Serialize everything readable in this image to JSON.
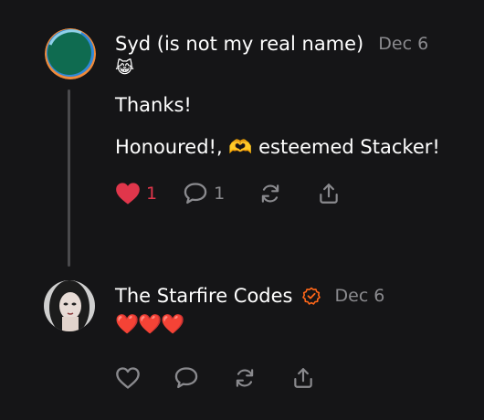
{
  "comments": [
    {
      "author": "Syd (is not my real name)",
      "date": "Dec 6",
      "emoji": "😹",
      "paragraphs": [
        "Thanks!",
        "Honoured!, 🫶 esteemed Stacker!"
      ],
      "like_count": "1",
      "reply_count": "1",
      "liked": true
    },
    {
      "author": "The Starfire Codes",
      "verified": true,
      "date": "Dec 6",
      "text": "❤️❤️❤️",
      "liked": false
    }
  ],
  "colors": {
    "background": "#151517",
    "text": "#ffffff",
    "muted": "#8a8a8e",
    "like_red": "#e0364b",
    "verified_orange": "#ff6719"
  },
  "icons": [
    "heart-icon",
    "comment-icon",
    "restack-icon",
    "share-icon",
    "verified-check-icon"
  ]
}
